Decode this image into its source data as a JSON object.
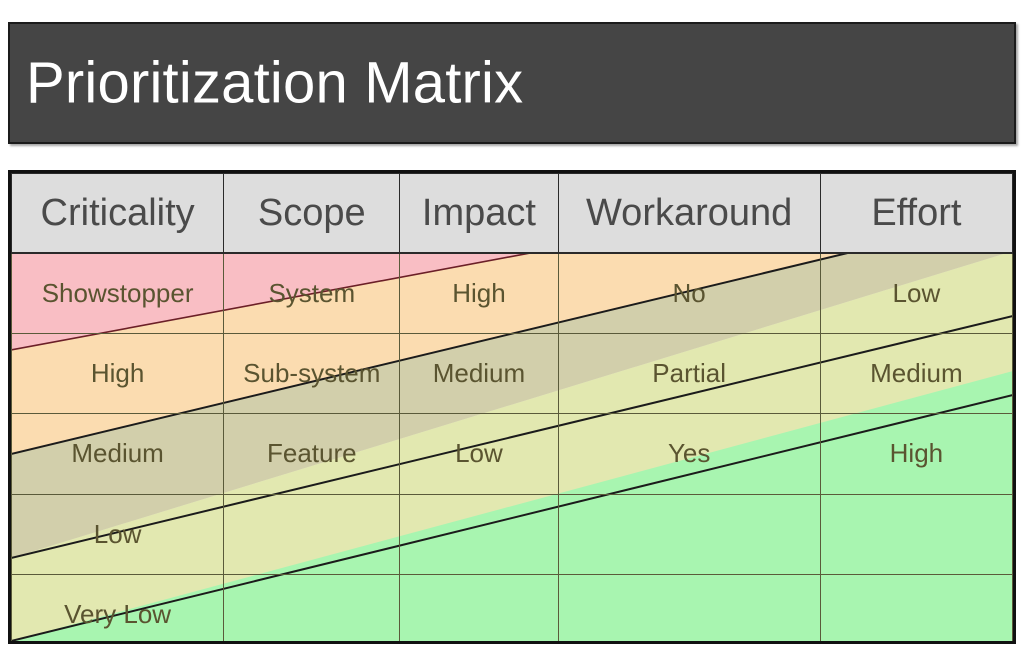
{
  "banner": {
    "title": "Prioritization Matrix",
    "background_color": "#454545",
    "text_color": "#ffffff"
  },
  "matrix": {
    "headers": [
      "Criticality",
      "Scope",
      "Impact",
      "Workaround",
      "Effort"
    ],
    "rows": [
      [
        "Showstopper",
        "System",
        "High",
        "No",
        "Low"
      ],
      [
        "High",
        "Sub-system",
        "Medium",
        "Partial",
        "Medium"
      ],
      [
        "Medium",
        "Feature",
        "Low",
        "Yes",
        "High"
      ],
      [
        "Low",
        "",
        "",
        "",
        ""
      ],
      [
        "Very Low",
        "",
        "",
        "",
        ""
      ]
    ],
    "header_background": "#dddddd",
    "header_text_color": "#4a4a4a",
    "cell_text_color": "#5a5430",
    "border_color": "#111111"
  },
  "bands": [
    {
      "name": "showstopper-band",
      "color": "#f9bec4"
    },
    {
      "name": "high-band",
      "color": "#fbdcb0"
    },
    {
      "name": "medium-band",
      "color": "#d2cfab"
    },
    {
      "name": "low-band",
      "color": "#e2e8b0"
    },
    {
      "name": "very-low-band",
      "color": "#a8f5b0"
    }
  ]
}
